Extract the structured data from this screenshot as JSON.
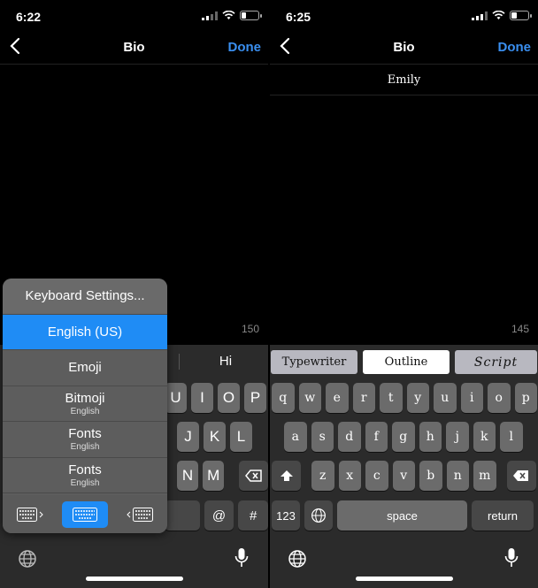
{
  "left": {
    "status": {
      "time": "6:22"
    },
    "nav": {
      "title": "Bio",
      "done": "Done"
    },
    "bio": {
      "text": ""
    },
    "char_count": "150",
    "suggestion": "Hi",
    "keyboard": {
      "row1": [
        "U",
        "I",
        "O",
        "P"
      ],
      "row2": [
        "J",
        "K",
        "L"
      ],
      "row3": [
        "N",
        "M"
      ],
      "row4": [
        "@",
        "#"
      ]
    },
    "popup": {
      "items": [
        {
          "label": "Keyboard Settings...",
          "sub": ""
        },
        {
          "label": "English (US)",
          "sub": ""
        },
        {
          "label": "Emoji",
          "sub": ""
        },
        {
          "label": "Bitmoji",
          "sub": "English"
        },
        {
          "label": "Fonts",
          "sub": "English"
        },
        {
          "label": "Fonts",
          "sub": "English"
        }
      ],
      "selected_index": 1,
      "modes": [
        "keyboard-left-icon",
        "keyboard-full-icon",
        "keyboard-right-icon"
      ],
      "selected_mode": 1
    }
  },
  "right": {
    "status": {
      "time": "6:25"
    },
    "nav": {
      "title": "Bio",
      "done": "Done"
    },
    "bio": {
      "text": "Emily"
    },
    "char_count": "145",
    "fontbar": [
      "Typewriter",
      "Outline",
      "Script"
    ],
    "fontbar_selected": 1,
    "keyboard": {
      "row1": [
        "q",
        "w",
        "e",
        "r",
        "t",
        "y",
        "u",
        "i",
        "o",
        "p"
      ],
      "row2": [
        "a",
        "s",
        "d",
        "f",
        "g",
        "h",
        "j",
        "k",
        "l"
      ],
      "row3": [
        "z",
        "x",
        "c",
        "v",
        "b",
        "n",
        "m"
      ],
      "num_label": "123",
      "space_label": "space",
      "return_label": "return"
    }
  },
  "colors": {
    "accent": "#1f8cf5",
    "done": "#3a8ff0",
    "key": "#6b6b6b",
    "key_dark": "#474747"
  }
}
